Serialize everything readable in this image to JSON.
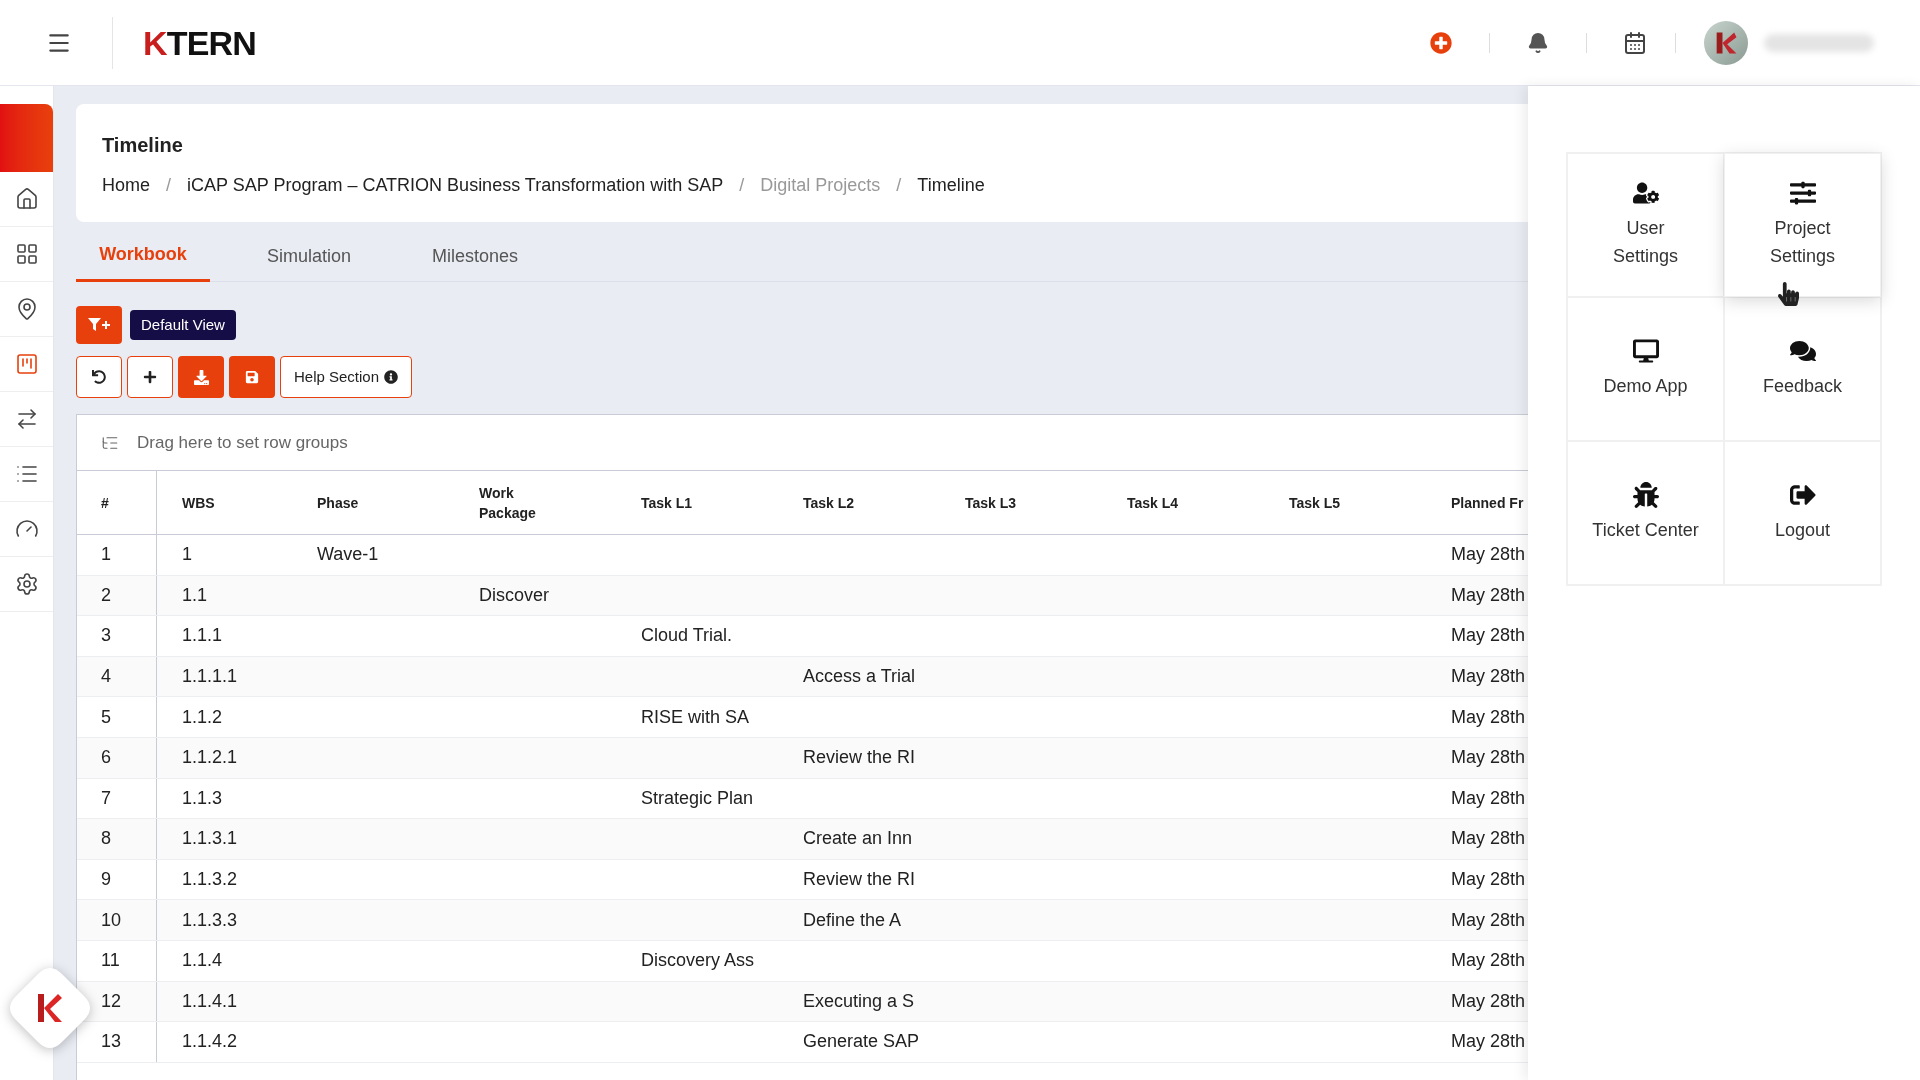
{
  "header": {
    "logo": {
      "mark": "K",
      "text": "TERN"
    }
  },
  "sidebar": {
    "items": [
      {
        "selected": false
      },
      {
        "selected": false
      },
      {
        "selected": false
      },
      {
        "selected": true
      },
      {
        "selected": false
      },
      {
        "selected": false
      },
      {
        "selected": false
      },
      {
        "selected": false
      }
    ]
  },
  "page": {
    "title": "Timeline",
    "separator": "/",
    "breadcrumbs": [
      {
        "label": "Home",
        "muted": false
      },
      {
        "label": "iCAP SAP Program – CATRION Business Transformation with SAP",
        "muted": false
      },
      {
        "label": "Digital Projects",
        "muted": true
      },
      {
        "label": "Timeline",
        "muted": false
      }
    ]
  },
  "tabs": [
    {
      "label": "Workbook",
      "selected": true
    },
    {
      "label": "Simulation",
      "selected": false
    },
    {
      "label": "Milestones",
      "selected": false
    }
  ],
  "view_badge": "Default View",
  "toolbar": {
    "help": "Help Section"
  },
  "table": {
    "group_placeholder": "Drag here to set row groups",
    "columns": [
      "#",
      "WBS",
      "Phase",
      "Work\nPackage",
      "Task L1",
      "Task L2",
      "Task L3",
      "Task L4",
      "Task L5",
      "Planned Fr"
    ],
    "rows": [
      [
        "1",
        "1",
        "Wave-1",
        "",
        "",
        "",
        "",
        "",
        "",
        "May 28th"
      ],
      [
        "2",
        "1.1",
        "",
        "Discover",
        "",
        "",
        "",
        "",
        "",
        "May 28th"
      ],
      [
        "3",
        "1.1.1",
        "",
        "",
        "Cloud Trial.",
        "",
        "",
        "",
        "",
        "May 28th"
      ],
      [
        "4",
        "1.1.1.1",
        "",
        "",
        "",
        "Access a Trial",
        "",
        "",
        "",
        "May 28th"
      ],
      [
        "5",
        "1.1.2",
        "",
        "",
        "RISE with SA",
        "",
        "",
        "",
        "",
        "May 28th"
      ],
      [
        "6",
        "1.1.2.1",
        "",
        "",
        "",
        "Review the RI",
        "",
        "",
        "",
        "May 28th"
      ],
      [
        "7",
        "1.1.3",
        "",
        "",
        "Strategic Plan",
        "",
        "",
        "",
        "",
        "May 28th"
      ],
      [
        "8",
        "1.1.3.1",
        "",
        "",
        "",
        "Create an Inn",
        "",
        "",
        "",
        "May 28th"
      ],
      [
        "9",
        "1.1.3.2",
        "",
        "",
        "",
        "Review the RI",
        "",
        "",
        "",
        "May 28th"
      ],
      [
        "10",
        "1.1.3.3",
        "",
        "",
        "",
        "Define the A",
        "",
        "",
        "",
        "May 28th"
      ],
      [
        "11",
        "1.1.4",
        "",
        "",
        "Discovery Ass",
        "",
        "",
        "",
        "",
        "May 28th"
      ],
      [
        "12",
        "1.1.4.1",
        "",
        "",
        "",
        "Executing a S",
        "",
        "",
        "",
        "May 28th"
      ],
      [
        "13",
        "1.1.4.2",
        "",
        "",
        "",
        "Generate SAP",
        "",
        "",
        "",
        "May 28th"
      ]
    ]
  },
  "menu": {
    "items": [
      {
        "kind": "user",
        "label": "User\nSettings",
        "highlighted": false
      },
      {
        "kind": "sliders",
        "label": "Project\nSettings",
        "highlighted": true
      },
      {
        "kind": "monitor",
        "label": "Demo App",
        "highlighted": false
      },
      {
        "kind": "chat",
        "label": "Feedback",
        "highlighted": false
      },
      {
        "kind": "bug",
        "label": "Ticket Center",
        "highlighted": false
      },
      {
        "kind": "logout",
        "label": "Logout",
        "highlighted": false
      }
    ]
  }
}
